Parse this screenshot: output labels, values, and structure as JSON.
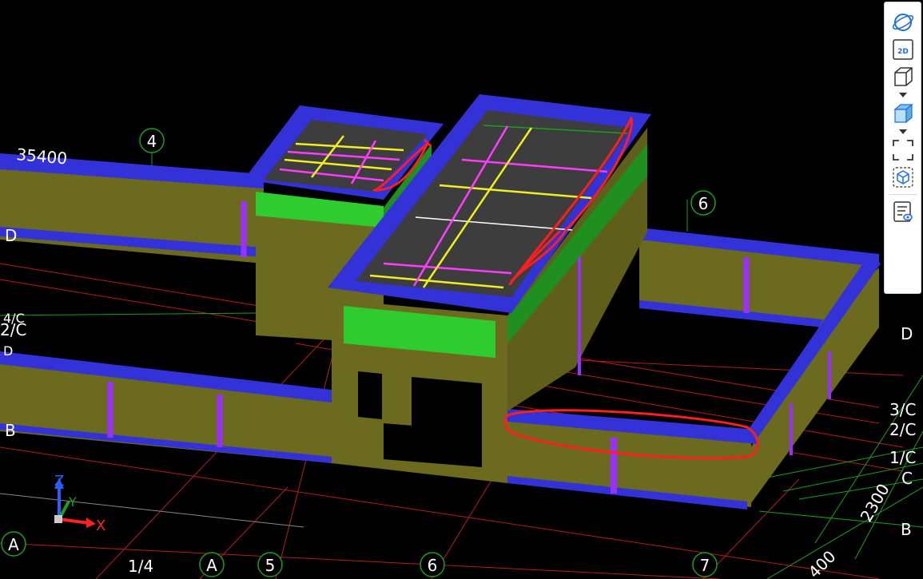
{
  "toolbar": {
    "items": [
      {
        "icon": "orbit-icon"
      },
      {
        "icon": "view-2d-icon",
        "label": "2D"
      },
      {
        "icon": "cube-wireframe-icon"
      },
      {
        "icon": "cube-shaded-icon"
      },
      {
        "icon": "zoom-extents-icon"
      },
      {
        "icon": "isolate-cube-icon"
      },
      {
        "icon": "view-properties-icon"
      }
    ],
    "accent": "#1e6fd9"
  },
  "dimensions": [
    "35400",
    "2300",
    "400"
  ],
  "grid_bubbles": [
    "4",
    "6",
    "A",
    "A",
    "5",
    "6",
    "7"
  ],
  "grid_labels": [
    "D",
    "2/C",
    "4/C",
    "D",
    "B",
    "D",
    "3/C",
    "2/C",
    "1/C",
    "C",
    "B",
    "1/4"
  ],
  "axis": {
    "x": "X",
    "y": "Y",
    "z": "Z"
  },
  "colors": {
    "background": "#000000",
    "wall": "#6b6a1f",
    "beam": "#3232d8",
    "slab_edge": "#2ecc2e",
    "gridline": "#d02020",
    "axisline": "#1aa01a",
    "markup": "#ff1e1e",
    "rebar_magenta": "#ff3cff",
    "rebar_yellow": "#f0f020"
  }
}
